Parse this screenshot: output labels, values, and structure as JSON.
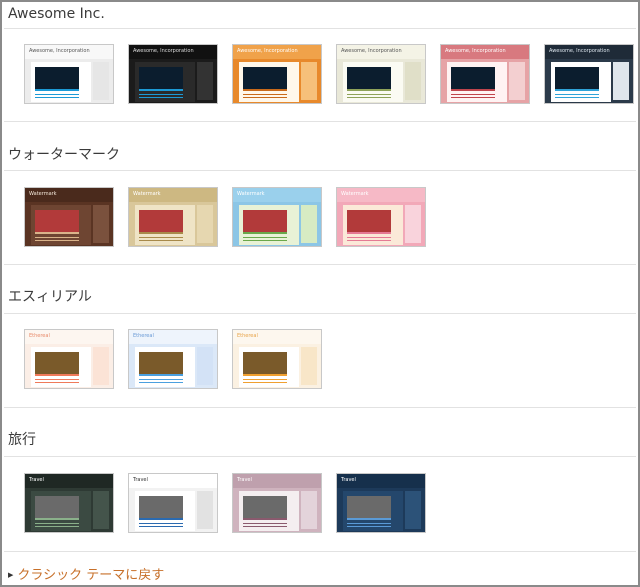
{
  "sections": [
    {
      "title": "Awesome Inc.",
      "thumbs": [
        {
          "header": "Awesome, Incorporation",
          "bg": "#ececec",
          "hdr": "#f8f8f8",
          "hdrText": "#555555",
          "post": "#ffffff",
          "img": "#0b1d2e",
          "side": "#e6e6e6",
          "accent": "#1c9ad6"
        },
        {
          "header": "Awesome, Incorporation",
          "bg": "#1b1b1b",
          "hdr": "#111111",
          "hdrText": "#dddddd",
          "post": "#2a2a2a",
          "img": "#0b1d2e",
          "side": "#333333",
          "accent": "#1c9ad6"
        },
        {
          "header": "Awesome, Incorporation",
          "bg": "#e8892b",
          "hdr": "#f0a24a",
          "hdrText": "#ffffff",
          "post": "#fff7ea",
          "img": "#0b1d2e",
          "side": "#f6c07a",
          "accent": "#c96a1a"
        },
        {
          "header": "Awesome, Incorporation",
          "bg": "#e9e8d8",
          "hdr": "#f4f3e6",
          "hdrText": "#555555",
          "post": "#fbfbf3",
          "img": "#0b1d2e",
          "side": "#e0dfc8",
          "accent": "#8fa35a"
        },
        {
          "header": "Awesome, Incorporation",
          "bg": "#e6a3a6",
          "hdr": "#d8797f",
          "hdrText": "#ffffff",
          "post": "#fff3f3",
          "img": "#0b1d2e",
          "side": "#f3cfd0",
          "accent": "#c0454d"
        },
        {
          "header": "Awesome, Incorporation",
          "bg": "#2b3a4a",
          "hdr": "#1f2b38",
          "hdrText": "#dde6ee",
          "post": "#ffffff",
          "img": "#0b1d2e",
          "side": "#dfe6ec",
          "accent": "#2fa3d8"
        }
      ]
    },
    {
      "title": "ウォーターマーク",
      "thumbs": [
        {
          "header": "Watermark",
          "bg": "#5a3423",
          "hdr": "#4a2a1c",
          "hdrText": "#f2e6d8",
          "post": "#6e4532",
          "img": "#b23a3a",
          "side": "#7a513d",
          "accent": "#d9b38a"
        },
        {
          "header": "Watermark",
          "bg": "#d9c79a",
          "hdr": "#cdb882",
          "hdrText": "#ffffff",
          "post": "#efe4c6",
          "img": "#b23a3a",
          "side": "#e6d7b0",
          "accent": "#a88a4a"
        },
        {
          "header": "Watermark",
          "bg": "#8cc6e6",
          "hdr": "#9ad0ec",
          "hdrText": "#ffffff",
          "post": "#e8f2d6",
          "img": "#b23a3a",
          "side": "#d7ebc3",
          "accent": "#6aa84a"
        },
        {
          "header": "Watermark",
          "bg": "#f2a8b8",
          "hdr": "#f6b9c6",
          "hdrText": "#ffffff",
          "post": "#fbe9d8",
          "img": "#b23a3a",
          "side": "#f9d3dc",
          "accent": "#e57a94"
        }
      ]
    },
    {
      "title": "エスィリアル",
      "thumbs": [
        {
          "header": "Ethereal",
          "bg": "#fbeee6",
          "hdr": "#fdf6f0",
          "hdrText": "#e88a6a",
          "post": "#ffffff",
          "img": "#7a5a2a",
          "side": "#fbe3d6",
          "accent": "#f07a5a"
        },
        {
          "header": "Ethereal",
          "bg": "#dbe8f8",
          "hdr": "#eef4fc",
          "hdrText": "#6a9ad6",
          "post": "#ffffff",
          "img": "#7a5a2a",
          "side": "#d3e2f6",
          "accent": "#4aa0e0"
        },
        {
          "header": "Ethereal",
          "bg": "#fbf1e2",
          "hdr": "#fdf7ee",
          "hdrText": "#e8a44a",
          "post": "#ffffff",
          "img": "#7a5a2a",
          "side": "#f8e6c8",
          "accent": "#f0a030"
        }
      ]
    },
    {
      "title": "旅行",
      "thumbs": [
        {
          "header": "Travel",
          "bg": "#2e3a34",
          "hdr": "#1f2824",
          "hdrText": "#ffffff",
          "post": "#3b4a42",
          "img": "#6a6a6a",
          "side": "#44544b",
          "accent": "#8ab08a"
        },
        {
          "header": "Travel",
          "bg": "#f2f2f2",
          "hdr": "#ffffff",
          "hdrText": "#333333",
          "post": "#ffffff",
          "img": "#6a6a6a",
          "side": "#e2e2e2",
          "accent": "#2a6ab0"
        },
        {
          "header": "Travel",
          "bg": "#cfb3be",
          "hdr": "#bfa0ad",
          "hdrText": "#ffffff",
          "post": "#f4eef0",
          "img": "#6a6a6a",
          "side": "#e3d3da",
          "accent": "#8a5a6e"
        },
        {
          "header": "Travel",
          "bg": "#1d3a5a",
          "hdr": "#16304c",
          "hdrText": "#ffffff",
          "post": "#24476c",
          "img": "#6a6a6a",
          "side": "#2c5278",
          "accent": "#5a9ad6"
        }
      ]
    }
  ],
  "footer": {
    "revert_label": "クラシック テーマに戻す"
  }
}
